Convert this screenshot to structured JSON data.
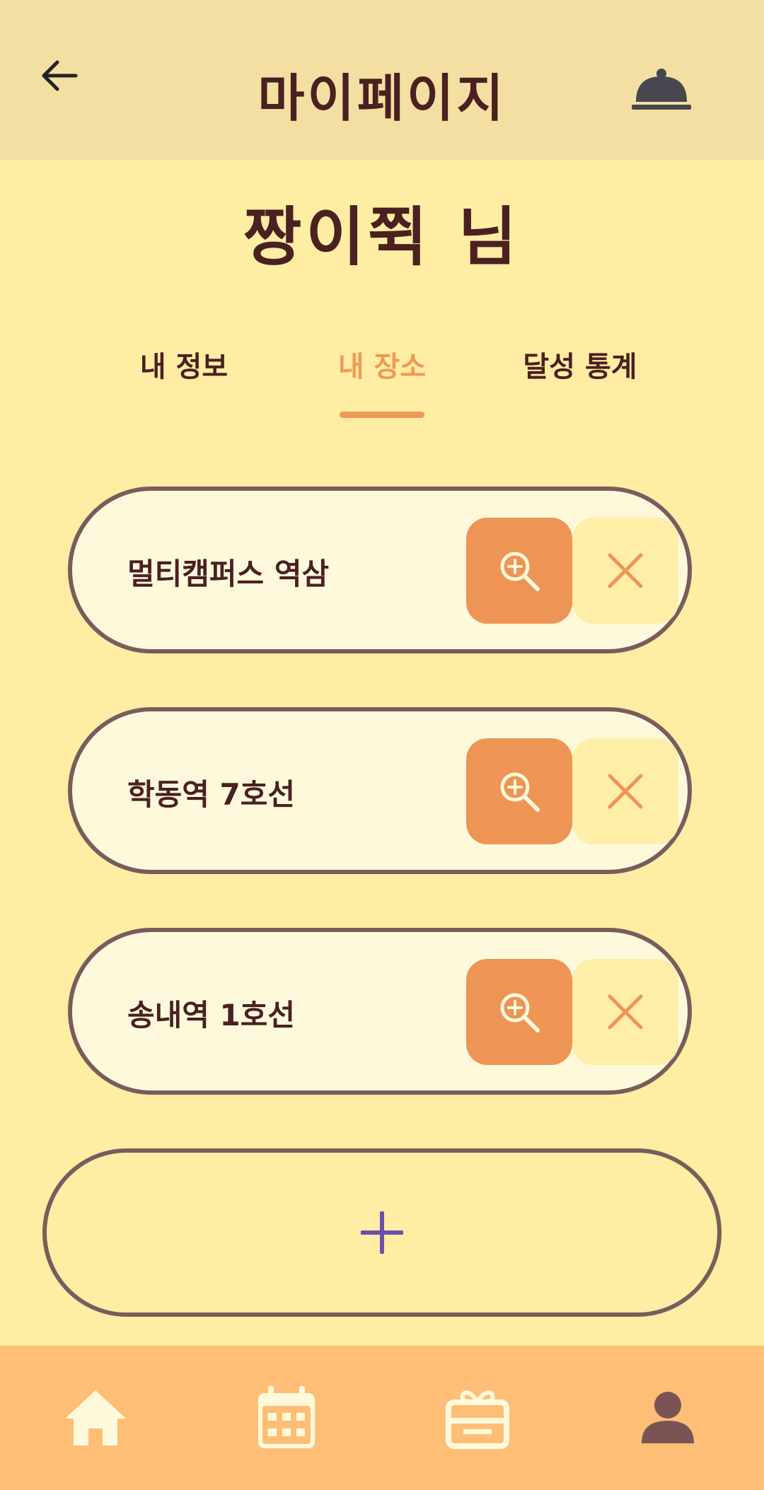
{
  "header": {
    "title": "마이페이지",
    "back_icon": "arrow-left-icon",
    "notification_icon": "bell-icon"
  },
  "profile": {
    "user_name": "짱이쮝 님"
  },
  "tabs": [
    {
      "label": "내 정보",
      "active": false
    },
    {
      "label": "내 장소",
      "active": true
    },
    {
      "label": "달성 통계",
      "active": false
    }
  ],
  "places": [
    {
      "name": "멀티캠퍼스 역삼"
    },
    {
      "name": "학동역 7호선"
    },
    {
      "name": "송내역 1호선"
    }
  ],
  "place_actions": {
    "zoom_icon": "zoom-in-icon",
    "remove_icon": "close-icon"
  },
  "add_place": {
    "icon": "plus-icon"
  },
  "bottom_nav": {
    "items": [
      {
        "icon": "home-icon",
        "active": false
      },
      {
        "icon": "calendar-icon",
        "active": false
      },
      {
        "icon": "gift-icon",
        "active": false
      },
      {
        "icon": "person-icon",
        "active": true
      }
    ]
  },
  "colors": {
    "background": "#FFEDA3",
    "header": "#F3DFA2",
    "accent": "#EE9A55",
    "text": "#4A2020",
    "card_border": "#7A5C5C",
    "card_fill": "#FFF9DC",
    "nav_bar": "#FFBE76",
    "plus": "#6A4FB0"
  }
}
